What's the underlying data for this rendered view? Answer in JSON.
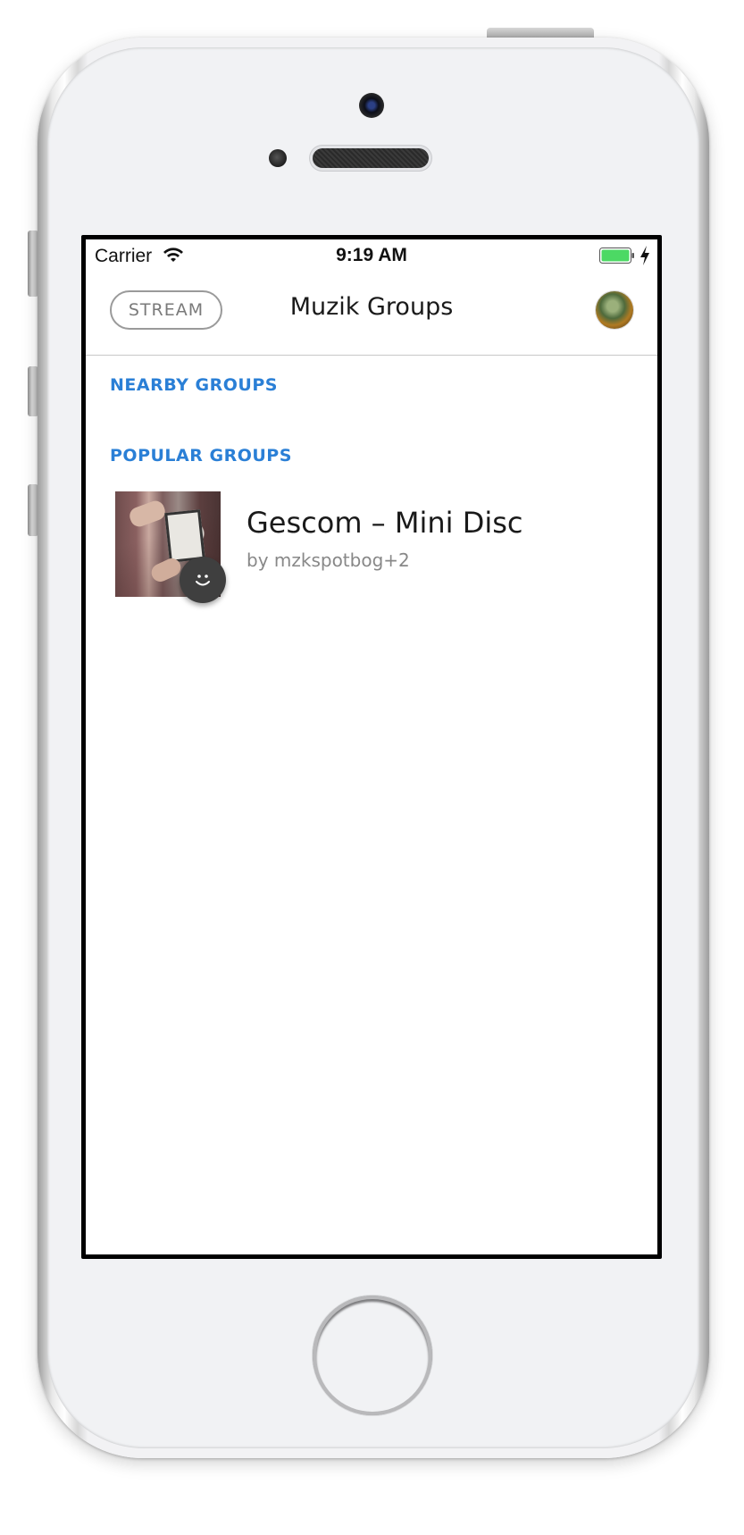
{
  "status_bar": {
    "carrier": "Carrier",
    "time": "9:19 AM",
    "wifi_icon": "wifi-icon",
    "battery_icon": "battery-icon",
    "battery_color": "#4cd964",
    "charging_icon": "charging-bolt-icon"
  },
  "nav": {
    "stream_label": "STREAM",
    "title": "Muzik Groups",
    "avatar_icon": "user-avatar"
  },
  "sections": {
    "nearby_label": "NEARBY GROUPS",
    "popular_label": "POPULAR GROUPS"
  },
  "groups": [
    {
      "title": "Gescom – Mini Disc",
      "subtitle": "by mzkspotbog+2",
      "badge_icon": "smiley-icon"
    }
  ],
  "colors": {
    "section_header": "#2a7fd6",
    "title_text": "#1a1a1a",
    "secondary_text": "#888888",
    "badge_background": "#3f3f3f"
  }
}
